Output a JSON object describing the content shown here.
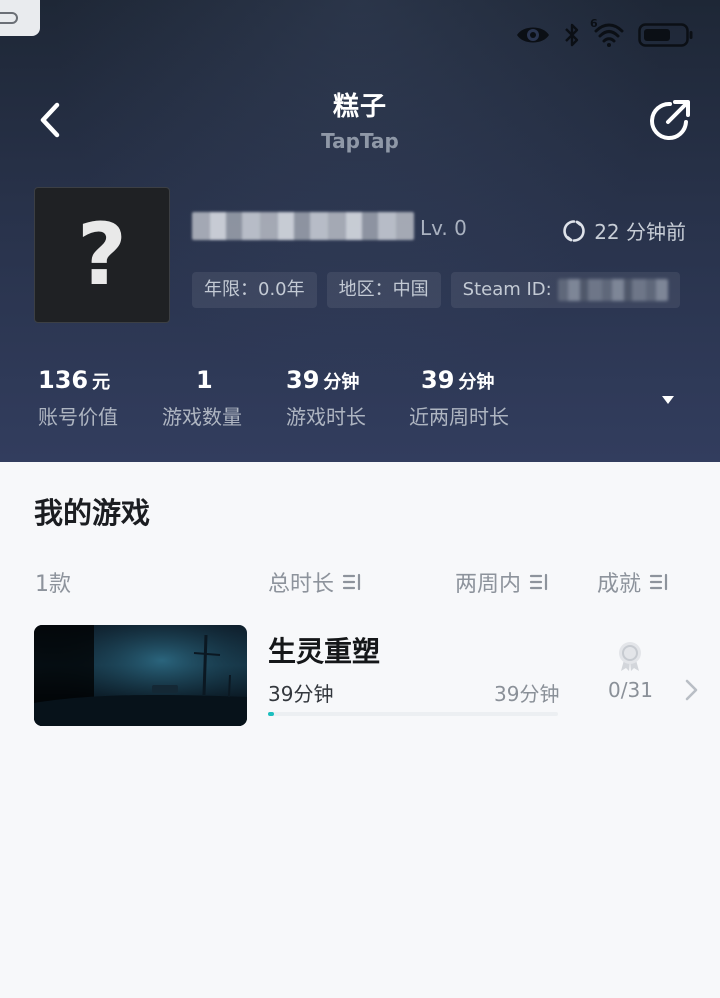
{
  "status_bar": {
    "icons": [
      "eye-icon",
      "bluetooth-icon",
      "wifi-icon",
      "battery-icon"
    ],
    "wifi_badge": "6"
  },
  "nav": {
    "title": "糕子",
    "brand": "TapTap"
  },
  "profile": {
    "avatar_glyph": "?",
    "level": "Lv. 0",
    "last_sync": "22 分钟前",
    "chips": {
      "years": "年限：0.0年",
      "region": "地区：中国",
      "steam_id_label": "Steam ID:"
    }
  },
  "stats": [
    {
      "value": "136",
      "unit": "元",
      "label": "账号价值"
    },
    {
      "value": "1",
      "unit": "",
      "label": "游戏数量"
    },
    {
      "value": "39",
      "unit": "分钟",
      "label": "游戏时长"
    },
    {
      "value": "39",
      "unit": "分钟",
      "label": "近两周时长"
    }
  ],
  "games_section": {
    "title": "我的游戏",
    "headers": {
      "count": "1款",
      "total": "总时长",
      "recent": "两周内",
      "achievements": "成就"
    },
    "games": [
      {
        "name": "生灵重塑",
        "total_time": "39分钟",
        "recent_time": "39分钟",
        "achievements": "0/31",
        "achievement_progress": 0.02
      }
    ]
  },
  "colors": {
    "header_bg": "#28324a",
    "progress_accent": "#1dbfbf",
    "page_bg": "#f7f8fa"
  }
}
